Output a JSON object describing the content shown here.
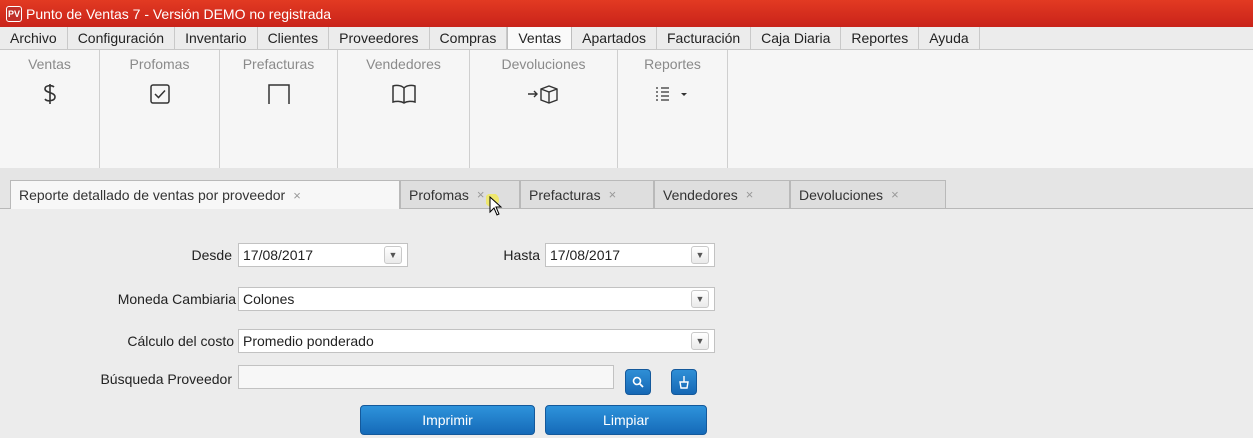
{
  "window": {
    "title": "Punto de Ventas 7 - Versión DEMO no registrada",
    "icon_text": "PV"
  },
  "menu": [
    {
      "label": "Archivo"
    },
    {
      "label": "Configuración"
    },
    {
      "label": "Inventario"
    },
    {
      "label": "Clientes"
    },
    {
      "label": "Proveedores"
    },
    {
      "label": "Compras"
    },
    {
      "label": "Ventas"
    },
    {
      "label": "Apartados"
    },
    {
      "label": "Facturación"
    },
    {
      "label": "Caja Diaria"
    },
    {
      "label": "Reportes"
    },
    {
      "label": "Ayuda"
    }
  ],
  "ribbon": [
    {
      "label": "Ventas",
      "icon": "dollar-icon"
    },
    {
      "label": "Profomas",
      "icon": "checkbox-icon"
    },
    {
      "label": "Prefacturas",
      "icon": "frame-icon"
    },
    {
      "label": "Vendedores",
      "icon": "book-icon"
    },
    {
      "label": "Devoluciones",
      "icon": "return-box-icon"
    },
    {
      "label": "Reportes",
      "icon": "list-icon"
    }
  ],
  "tabs": [
    {
      "label": "Reporte detallado de ventas por proveedor"
    },
    {
      "label": "Profomas"
    },
    {
      "label": "Prefacturas"
    },
    {
      "label": "Vendedores"
    },
    {
      "label": "Devoluciones"
    }
  ],
  "tab_close": "×",
  "form": {
    "desde_label": "Desde",
    "desde_value": "17/08/2017",
    "hasta_label": "Hasta",
    "hasta_value": "17/08/2017",
    "moneda_label": "Moneda Cambiaria",
    "moneda_value": "Colones",
    "calculo_label": "Cálculo del costo",
    "calculo_value": "Promedio ponderado",
    "busqueda_label": "Búsqueda Proveedor",
    "busqueda_value": "",
    "imprimir_label": "Imprimir",
    "limpiar_label": "Limpiar"
  }
}
